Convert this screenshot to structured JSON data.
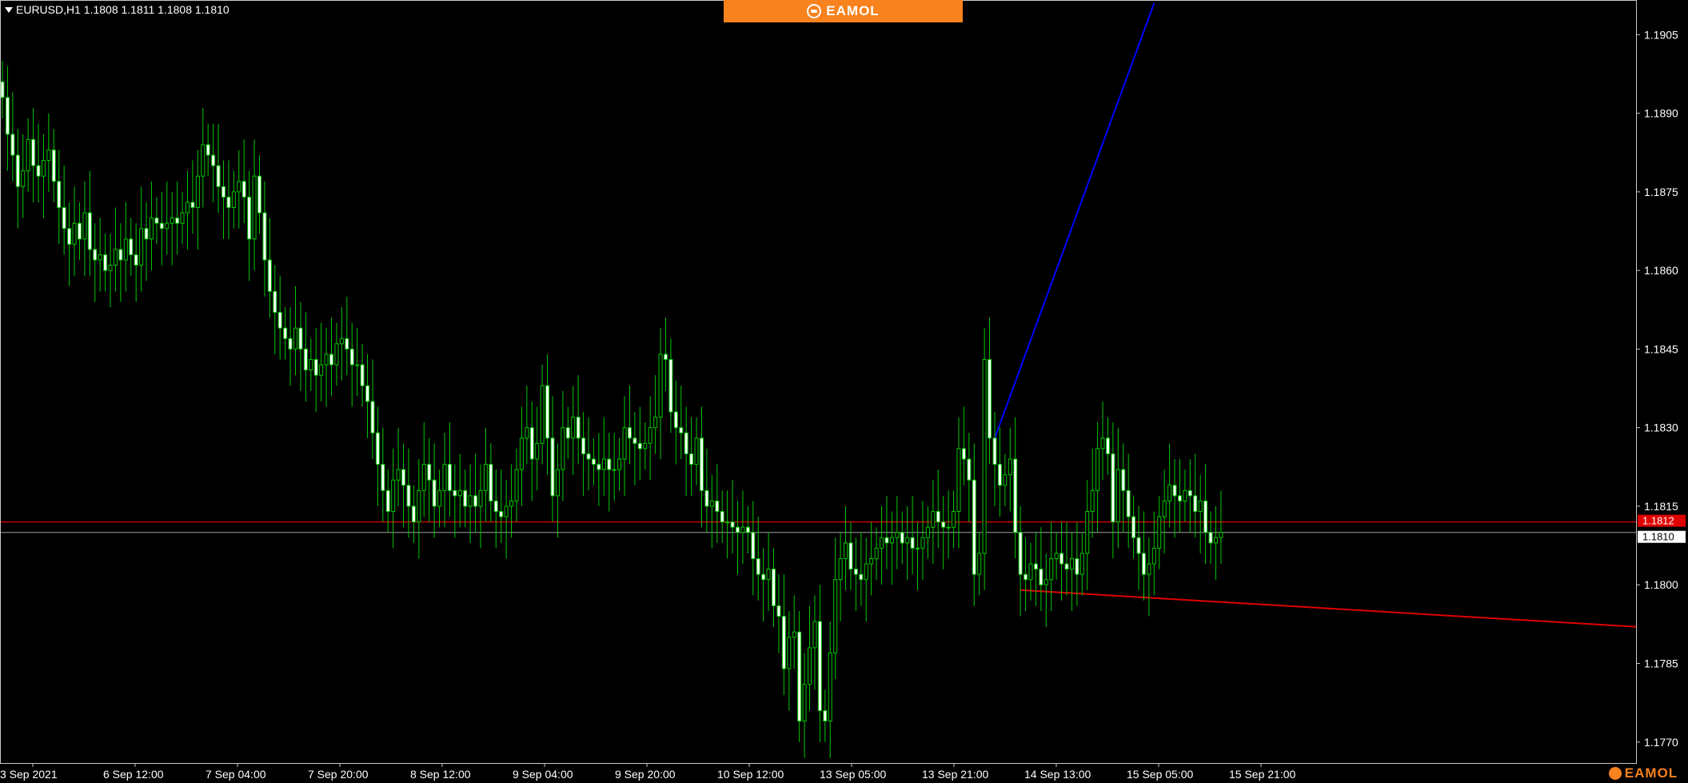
{
  "header": {
    "symbol_text": "EURUSD,H1  1.1808 1.1811 1.1808 1.1810",
    "banner_text": "EAMOL",
    "corner_brand": "EAMOL"
  },
  "colors": {
    "background": "#000000",
    "grid_frame": "#c8c8c8",
    "candle_up_body": "#000000",
    "candle_down_body": "#ffffff",
    "candle_wick": "#00c800",
    "bid_line": "#a0a0a0",
    "level_line": "#e00000",
    "trend_up": "#0000ff",
    "trend_down": "#e00000",
    "banner": "#f7821e"
  },
  "chart_data": {
    "type": "candlestick",
    "symbol": "EURUSD",
    "timeframe": "H1",
    "ohlc_last": {
      "open": 1.1808,
      "high": 1.1811,
      "low": 1.1808,
      "close": 1.181
    },
    "ylim": [
      1.1766,
      1.1911
    ],
    "y_ticks": [
      "1.1905",
      "1.1890",
      "1.1875",
      "1.1860",
      "1.1845",
      "1.1830",
      "1.1815",
      "1.1800",
      "1.1785",
      "1.1770"
    ],
    "x_ticks": [
      "3 Sep 2021",
      "6 Sep 12:00",
      "7 Sep 04:00",
      "7 Sep 20:00",
      "8 Sep 12:00",
      "9 Sep 04:00",
      "9 Sep 20:00",
      "10 Sep 12:00",
      "13 Sep 05:00",
      "13 Sep 21:00",
      "14 Sep 13:00",
      "15 Sep 05:00",
      "15 Sep 21:00"
    ],
    "price_labels": {
      "current": "1.1810",
      "level": "1.1812"
    },
    "level_price": 1.1812,
    "current_price": 1.181,
    "trendline_up": {
      "from_bar": 193,
      "from_price": 1.1828,
      "to_bar": 224,
      "to_price": 1.1911
    },
    "trendline_down": {
      "from_bar": 198,
      "from_price": 1.1799,
      "to_bar": 318,
      "to_price": 1.1792
    },
    "closes": [
      1.1893,
      1.1886,
      1.1882,
      1.1876,
      1.1879,
      1.1885,
      1.188,
      1.1878,
      1.1881,
      1.1883,
      1.1877,
      1.1872,
      1.1868,
      1.1865,
      1.1869,
      1.1866,
      1.1871,
      1.1864,
      1.1862,
      1.1863,
      1.186,
      1.1861,
      1.1864,
      1.1862,
      1.1866,
      1.1863,
      1.1861,
      1.1868,
      1.1866,
      1.187,
      1.1869,
      1.1868,
      1.1869,
      1.187,
      1.1869,
      1.1871,
      1.1873,
      1.1872,
      1.1878,
      1.1884,
      1.1882,
      1.188,
      1.1876,
      1.1874,
      1.1872,
      1.1875,
      1.1877,
      1.1874,
      1.1866,
      1.1878,
      1.1871,
      1.1862,
      1.1856,
      1.1852,
      1.1849,
      1.1847,
      1.1845,
      1.1849,
      1.1845,
      1.1841,
      1.1843,
      1.184,
      1.1842,
      1.1844,
      1.1842,
      1.1846,
      1.1847,
      1.1845,
      1.1842,
      1.1842,
      1.1838,
      1.1835,
      1.1829,
      1.1823,
      1.1818,
      1.1814,
      1.182,
      1.1822,
      1.1819,
      1.1815,
      1.1812,
      1.1818,
      1.1823,
      1.182,
      1.1815,
      1.1818,
      1.1823,
      1.1818,
      1.1817,
      1.1818,
      1.1815,
      1.1817,
      1.1815,
      1.1818,
      1.1823,
      1.1816,
      1.1814,
      1.1813,
      1.1815,
      1.1816,
      1.1822,
      1.1828,
      1.183,
      1.1824,
      1.1827,
      1.1838,
      1.1828,
      1.1817,
      1.1822,
      1.183,
      1.1828,
      1.1832,
      1.1828,
      1.1825,
      1.1824,
      1.1823,
      1.1822,
      1.1824,
      1.1822,
      1.1822,
      1.1824,
      1.183,
      1.1828,
      1.1827,
      1.1826,
      1.1827,
      1.183,
      1.1832,
      1.1844,
      1.1843,
      1.1833,
      1.183,
      1.1829,
      1.1825,
      1.1823,
      1.1828,
      1.1818,
      1.1815,
      1.1816,
      1.1814,
      1.1812,
      1.1812,
      1.1811,
      1.181,
      1.1811,
      1.181,
      1.1805,
      1.1802,
      1.1801,
      1.1803,
      1.1796,
      1.1794,
      1.1784,
      1.179,
      1.1791,
      1.1774,
      1.1781,
      1.1788,
      1.1793,
      1.1776,
      1.1774,
      1.1787,
      1.1801,
      1.1805,
      1.1808,
      1.1803,
      1.1802,
      1.1801,
      1.1804,
      1.1805,
      1.1807,
      1.1809,
      1.1808,
      1.1809,
      1.181,
      1.1808,
      1.1809,
      1.1807,
      1.1807,
      1.1809,
      1.1811,
      1.1814,
      1.1812,
      1.1811,
      1.1811,
      1.1814,
      1.1826,
      1.1824,
      1.182,
      1.1802,
      1.1806,
      1.1843,
      1.1828,
      1.1823,
      1.1819,
      1.1821,
      1.1824,
      1.181,
      1.1802,
      1.1801,
      1.1804,
      1.1803,
      1.18,
      1.1801,
      1.1805,
      1.1806,
      1.1804,
      1.1803,
      1.1805,
      1.1802,
      1.1806,
      1.1814,
      1.1818,
      1.1826,
      1.1828,
      1.1825,
      1.1812,
      1.1822,
      1.1818,
      1.1813,
      1.1809,
      1.1806,
      1.1802,
      1.1804,
      1.1807,
      1.1813,
      1.1816,
      1.1819,
      1.1817,
      1.1816,
      1.1818,
      1.1817,
      1.1814,
      1.1816,
      1.181,
      1.1808,
      1.1809,
      1.181
    ],
    "grid": false,
    "legend": "none"
  }
}
